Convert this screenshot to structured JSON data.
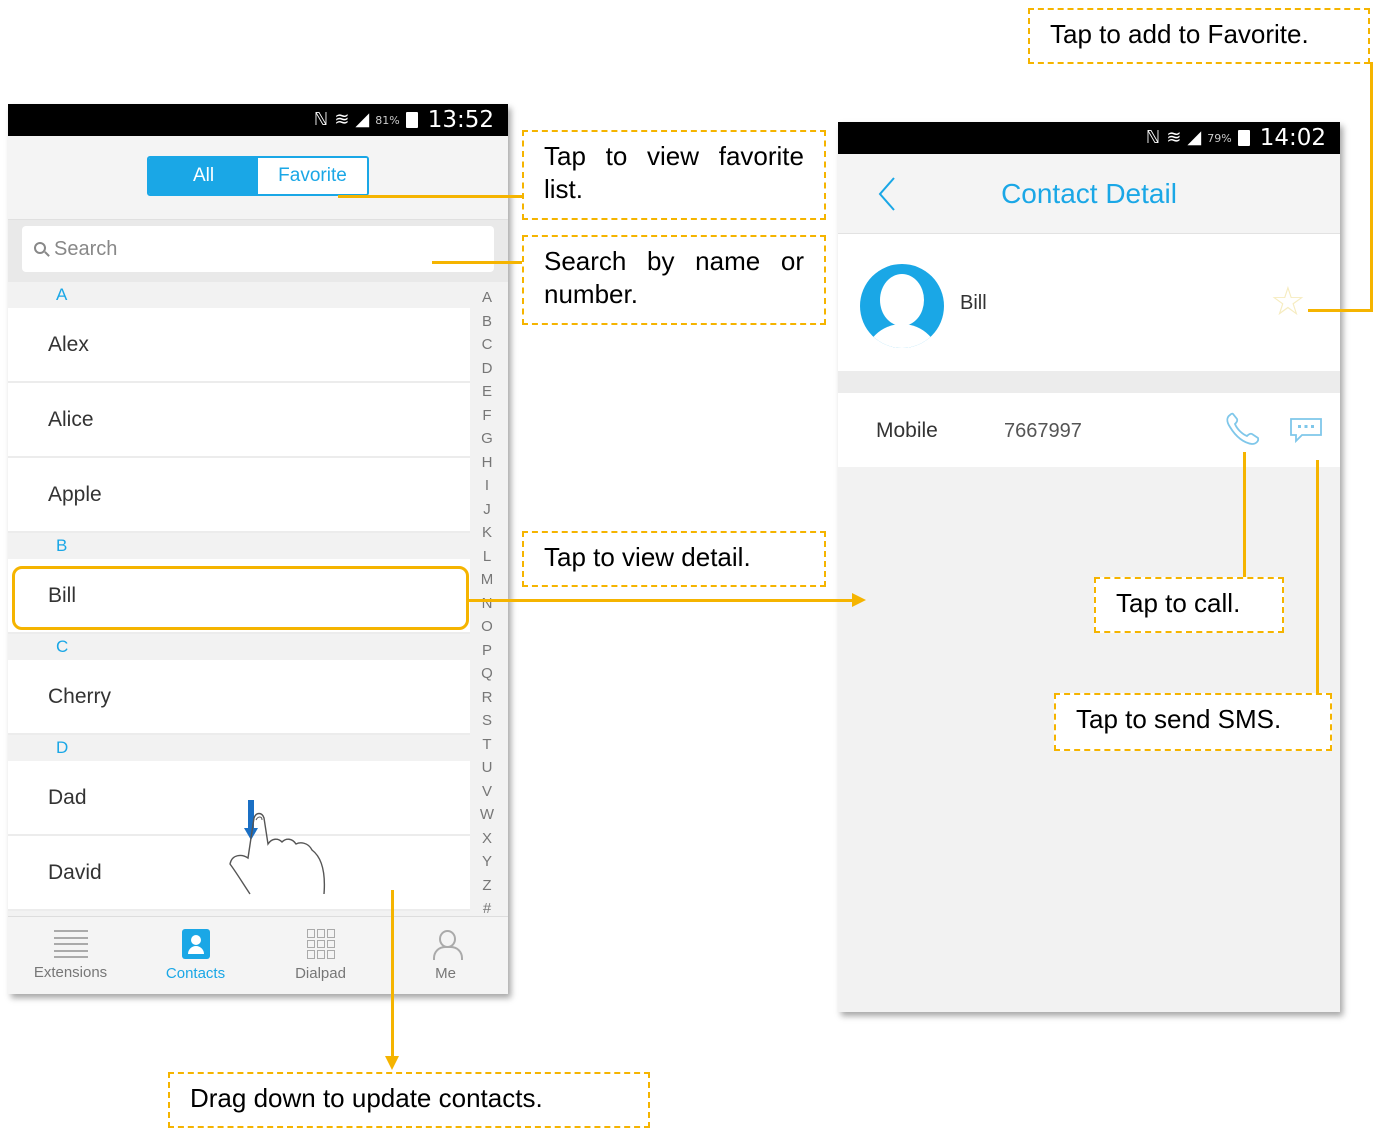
{
  "left_screen": {
    "status": {
      "battery": "81%",
      "time": "13:52"
    },
    "tabs": {
      "all": "All",
      "favorite": "Favorite"
    },
    "search": {
      "placeholder": "Search"
    },
    "sections": [
      {
        "letter": "A",
        "contacts": [
          "Alex",
          "Alice",
          "Apple"
        ]
      },
      {
        "letter": "B",
        "contacts": [
          "Bill"
        ]
      },
      {
        "letter": "C",
        "contacts": [
          "Cherry"
        ]
      },
      {
        "letter": "D",
        "contacts": [
          "Dad",
          "David"
        ]
      }
    ],
    "alphabet": [
      "A",
      "B",
      "C",
      "D",
      "E",
      "F",
      "G",
      "H",
      "I",
      "J",
      "K",
      "L",
      "M",
      "N",
      "O",
      "P",
      "Q",
      "R",
      "S",
      "T",
      "U",
      "V",
      "W",
      "X",
      "Y",
      "Z",
      "#"
    ],
    "bottom_nav": [
      "Extensions",
      "Contacts",
      "Dialpad",
      "Me"
    ],
    "active_nav": "Contacts"
  },
  "right_screen": {
    "status": {
      "battery": "79%",
      "time": "14:02"
    },
    "title": "Contact Detail",
    "contact_name": "Bill",
    "phone_label": "Mobile",
    "phone_number": "7667997",
    "favorite_star": "☆"
  },
  "callouts": {
    "add_favorite": "Tap to add to Favorite.",
    "view_favorite": "Tap to view favorite list.",
    "search": "Search by name or number.",
    "view_detail": "Tap to view detail.",
    "call": "Tap to call.",
    "sms": "Tap to send SMS.",
    "drag": "Drag down to update contacts."
  },
  "colors": {
    "accent": "#1aa7e6",
    "callout": "#f5b400"
  }
}
